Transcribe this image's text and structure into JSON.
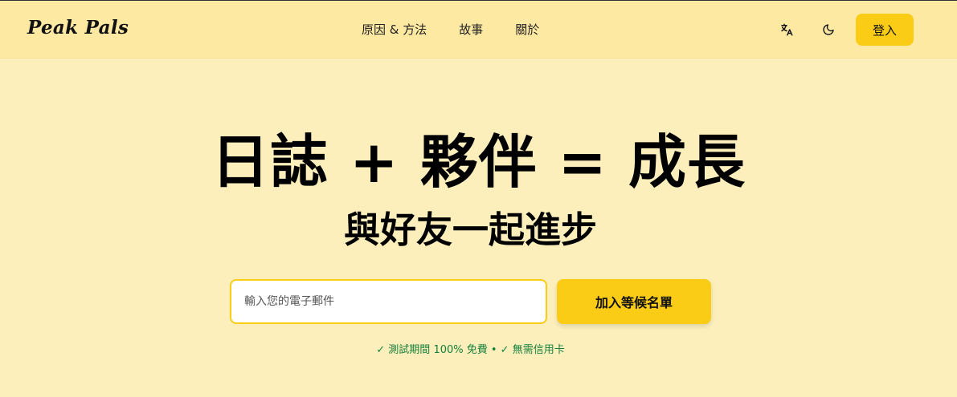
{
  "header": {
    "logo": "Peak Pals",
    "nav": [
      {
        "label": "原因 & 方法"
      },
      {
        "label": "故事"
      },
      {
        "label": "關於"
      }
    ],
    "translate_icon": "translate-icon",
    "theme_icon": "moon-icon",
    "login_label": "登入"
  },
  "hero": {
    "title": "日誌 + 夥伴 = 成長",
    "subtitle": "與好友一起進步",
    "email_placeholder": "輸入您的電子郵件",
    "join_label": "加入等候名單",
    "note": "✓ 測試期間 100% 免費 • ✓ 無需信用卡"
  },
  "colors": {
    "background": "#fdefbb",
    "header_bg": "#fde9a2",
    "accent": "#facc15",
    "note_green": "#15803d"
  }
}
